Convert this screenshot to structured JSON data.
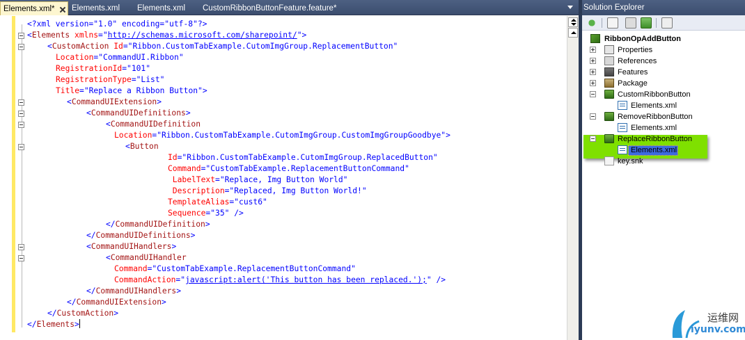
{
  "editor": {
    "tabs": [
      {
        "label": "Elements.xml*",
        "active": true
      },
      {
        "label": "Elements.xml",
        "active": false
      },
      {
        "label": "Elements.xml",
        "active": false
      },
      {
        "label": "CustomRibbonButtonFeature.feature*",
        "active": false
      }
    ],
    "code": [
      [
        {
          "t": "bl",
          "v": "<?xml version=\"1.0\" encoding=\"utf-8\"?>"
        }
      ],
      [
        {
          "t": "bl",
          "v": "<"
        },
        {
          "t": "tg",
          "v": "Elements"
        },
        {
          "t": "at",
          "v": " xmlns"
        },
        {
          "t": "bl",
          "v": "=\""
        },
        {
          "t": "lk",
          "v": "http://schemas.microsoft.com/sharepoint/"
        },
        {
          "t": "bl",
          "v": "\">"
        }
      ],
      [
        {
          "t": "bl",
          "v": "<"
        },
        {
          "t": "tg",
          "v": "CustomAction"
        },
        {
          "t": "at",
          "v": " Id"
        },
        {
          "t": "bl",
          "v": "=\"Ribbon.CustomTabExample.CutomImgGroup.ReplacementButton\""
        }
      ],
      [
        {
          "t": "at",
          "v": "Location"
        },
        {
          "t": "bl",
          "v": "=\"CommandUI.Ribbon\""
        }
      ],
      [
        {
          "t": "at",
          "v": "RegistrationId"
        },
        {
          "t": "bl",
          "v": "=\"101\""
        }
      ],
      [
        {
          "t": "at",
          "v": "RegistrationType"
        },
        {
          "t": "bl",
          "v": "=\"List\""
        }
      ],
      [
        {
          "t": "at",
          "v": "Title"
        },
        {
          "t": "bl",
          "v": "=\"Replace a Ribbon Button\">"
        }
      ],
      [
        {
          "t": "bl",
          "v": "<"
        },
        {
          "t": "tg",
          "v": "CommandUIExtension"
        },
        {
          "t": "bl",
          "v": ">"
        }
      ],
      [
        {
          "t": "bl",
          "v": "<"
        },
        {
          "t": "tg",
          "v": "CommandUIDefinitions"
        },
        {
          "t": "bl",
          "v": ">"
        }
      ],
      [
        {
          "t": "bl",
          "v": "<"
        },
        {
          "t": "tg",
          "v": "CommandUIDefinition"
        }
      ],
      [
        {
          "t": "at",
          "v": "Location"
        },
        {
          "t": "bl",
          "v": "=\"Ribbon.CustomTabExample.CutomImgGroup.CustomImgGroupGoodbye\">"
        }
      ],
      [
        {
          "t": "bl",
          "v": "<"
        },
        {
          "t": "tg",
          "v": "Button"
        }
      ],
      [
        {
          "t": "at",
          "v": "Id"
        },
        {
          "t": "bl",
          "v": "=\"Ribbon.CustomTabExample.CutomImgGroup.ReplacedButton\""
        }
      ],
      [
        {
          "t": "at",
          "v": "Command"
        },
        {
          "t": "bl",
          "v": "=\"CustomTabExample.ReplacementButtonCommand\""
        }
      ],
      [
        {
          "t": "at",
          "v": " LabelText"
        },
        {
          "t": "bl",
          "v": "=\"Replace, Img Button World\""
        }
      ],
      [
        {
          "t": "at",
          "v": " Description"
        },
        {
          "t": "bl",
          "v": "=\"Replaced, Img Button World!\""
        }
      ],
      [
        {
          "t": "at",
          "v": "TemplateAlias"
        },
        {
          "t": "bl",
          "v": "=\"cust6\""
        }
      ],
      [
        {
          "t": "at",
          "v": "Sequence"
        },
        {
          "t": "bl",
          "v": "=\"35\" />"
        }
      ],
      [
        {
          "t": "bl",
          "v": "</"
        },
        {
          "t": "tg",
          "v": "CommandUIDefinition"
        },
        {
          "t": "bl",
          "v": ">"
        }
      ],
      [
        {
          "t": "bl",
          "v": "</"
        },
        {
          "t": "tg",
          "v": "CommandUIDefinitions"
        },
        {
          "t": "bl",
          "v": ">"
        }
      ],
      [
        {
          "t": "bl",
          "v": "<"
        },
        {
          "t": "tg",
          "v": "CommandUIHandlers"
        },
        {
          "t": "bl",
          "v": ">"
        }
      ],
      [
        {
          "t": "bl",
          "v": "<"
        },
        {
          "t": "tg",
          "v": "CommandUIHandler"
        }
      ],
      [
        {
          "t": "at",
          "v": "Command"
        },
        {
          "t": "bl",
          "v": "=\"CustomTabExample.ReplacementButtonCommand\""
        }
      ],
      [
        {
          "t": "at",
          "v": "CommandAction"
        },
        {
          "t": "bl",
          "v": "=\""
        },
        {
          "t": "lk",
          "v": "javascript:alert('This button has been replaced.');"
        },
        {
          "t": "bl",
          "v": "\" />"
        }
      ],
      [
        {
          "t": "bl",
          "v": "</"
        },
        {
          "t": "tg",
          "v": "CommandUIHandlers"
        },
        {
          "t": "bl",
          "v": ">"
        }
      ],
      [
        {
          "t": "bl",
          "v": "</"
        },
        {
          "t": "tg",
          "v": "CommandUIExtension"
        },
        {
          "t": "bl",
          "v": ">"
        }
      ],
      [
        {
          "t": "bl",
          "v": "</"
        },
        {
          "t": "tg",
          "v": "CustomAction"
        },
        {
          "t": "bl",
          "v": ">"
        }
      ],
      [
        {
          "t": "bl",
          "v": "</"
        },
        {
          "t": "tg",
          "v": "Elements"
        },
        {
          "t": "bl",
          "v": ">"
        }
      ]
    ]
  },
  "solution": {
    "title": "Solution Explorer",
    "toolbar_icons": [
      "properties-icon",
      "show-all-files-icon",
      "refresh-icon",
      "view-code-icon",
      "view-designer-icon"
    ],
    "tree": [
      {
        "label": "RibbonOpAddButton",
        "icon": "project-icon",
        "bold": true
      },
      {
        "label": "Properties",
        "icon": "properties-icon",
        "expander": "plus"
      },
      {
        "label": "References",
        "icon": "references-icon",
        "expander": "plus"
      },
      {
        "label": "Features",
        "icon": "features-icon",
        "expander": "plus"
      },
      {
        "label": "Package",
        "icon": "package-icon",
        "expander": "plus"
      },
      {
        "label": "CustomRibbonButton",
        "icon": "element-folder-icon",
        "expander": "minus"
      },
      {
        "label": "Elements.xml",
        "icon": "xml-file-icon"
      },
      {
        "label": "RemoveRibbonButton",
        "icon": "element-folder-icon",
        "expander": "minus"
      },
      {
        "label": "Elements.xml",
        "icon": "xml-file-icon"
      },
      {
        "label": "ReplaceRibbonButton",
        "icon": "element-folder-icon",
        "expander": "minus"
      },
      {
        "label": "Elements.xml",
        "icon": "xml-file-icon",
        "selected": true
      },
      {
        "label": "key.snk",
        "icon": "key-file-icon"
      }
    ]
  },
  "watermark": {
    "line1": "运维网",
    "line2": "iyunv.com"
  },
  "colors": {
    "tag": "#a31515",
    "attribute": "#ff0000",
    "value": "#0000ff",
    "highlight": "#7fe000",
    "selection": "#3d6ae0",
    "margin": "#ffe964"
  }
}
